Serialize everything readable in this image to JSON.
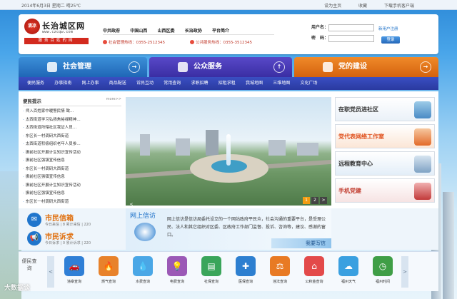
{
  "topbar": {
    "date_text": "2014年6月3日  星期二  晴25℃",
    "links": [
      "设为主页",
      "收藏",
      "下载手机客户端"
    ]
  },
  "header": {
    "logo_badge": "清凉",
    "logo_title": "长治城区网",
    "logo_url": "www.czcqw.com",
    "logo_slogan": "服务百姓的网",
    "nav": [
      "中共政府",
      "中国山西",
      "山西区委",
      "长治政协",
      "平台简介"
    ],
    "hotline_1": "社会管理热线：0355-2512345",
    "hotline_2": "公共服务热线：0355-3512345",
    "login_user_label": "用户名：",
    "login_pwd_label": "密　码：",
    "login_user_placeholder": "",
    "login_pwd_placeholder": "",
    "register_link": "新用户注册",
    "login_button": "登录"
  },
  "tabs": [
    {
      "label": "社会管理",
      "arrow": "→",
      "color": "#2a74c4"
    },
    {
      "label": "公众服务",
      "arrow": "↑",
      "color": "#4637b4"
    },
    {
      "label": "党的建设",
      "arrow": "→",
      "color": "#e3731c"
    }
  ],
  "subnav": [
    "便民服务",
    "办事指南",
    "网上办事",
    "商品配送",
    "诉民互动",
    "常用查询",
    "求职招聘",
    "招租求租",
    "我城地图",
    "三维地图",
    "文化广场"
  ],
  "news": {
    "title": "便民提示",
    "more": "more>>",
    "items": [
      "师入百姓家中暖警民情  致…",
      "太西街道学习弘扬焦裕禄精神…",
      "太西街道所辖社区我证人员…",
      "东区长一村调研大西街道",
      "太西街道积极组织老年人员参…",
      "振前社区开展计生知识宣传活动",
      "振前社区强镇宣传信息",
      "东区长一村调研大西街道",
      "振前社区强镇宣传信息",
      "振前社区开展计生知识宣传活动",
      "振前社区强镇宣传信息",
      "东区长一村调研大西街道"
    ]
  },
  "slider": {
    "prev": "<",
    "next": ">",
    "pages": [
      "1",
      "2"
    ]
  },
  "right_links": [
    "在职党员进社区",
    "党代表网络工作室",
    "远程教育中心",
    "手机党建"
  ],
  "services": {
    "mailbox_title": "市民信箱",
    "mailbox_stats": "今日来信 | 8  累计来信 | 220",
    "appeal_title": "市民诉求",
    "appeal_stats": "今日诉求 | 0  累计诉求 | 220",
    "online_title": "网上信访",
    "online_desc": "网上信访是信访局委托设立的一个网站政府平民众，社会沟通的重要平台，是受理公民、法人和其它组织对区委、区政府工作部门监督、投诉、咨询等，建议、感谢的窗口。",
    "write_button": "我要写信"
  },
  "query": {
    "title": "便民查询",
    "left_arrow": "<",
    "right_arrow": ">",
    "items": [
      {
        "label": "违章查询",
        "icon": "car-icon",
        "color": "#2f7fd6",
        "glyph": "🚗"
      },
      {
        "label": "燃气查询",
        "icon": "flame-icon",
        "color": "#e8822b",
        "glyph": "🔥"
      },
      {
        "label": "水费查询",
        "icon": "tap-icon",
        "color": "#4aa7e6",
        "glyph": "💧"
      },
      {
        "label": "电费查询",
        "icon": "bulb-icon",
        "color": "#9b59b6",
        "glyph": "💡"
      },
      {
        "label": "社保查询",
        "icon": "card-icon",
        "color": "#3aa55a",
        "glyph": "▤"
      },
      {
        "label": "医保查询",
        "icon": "cross-icon",
        "color": "#2d7fd0",
        "glyph": "✚"
      },
      {
        "label": "违法查询",
        "icon": "gavel-icon",
        "color": "#e87a24",
        "glyph": "⚖"
      },
      {
        "label": "公积金查询",
        "icon": "house-icon",
        "color": "#e34a4a",
        "glyph": "⌂"
      },
      {
        "label": "福州天气",
        "icon": "cloud-icon",
        "color": "#3aa0e0",
        "glyph": "☁"
      },
      {
        "label": "福州时间",
        "icon": "clock-icon",
        "color": "#3f9e46",
        "glyph": "◷"
      }
    ]
  },
  "watermark": "大数据谈"
}
